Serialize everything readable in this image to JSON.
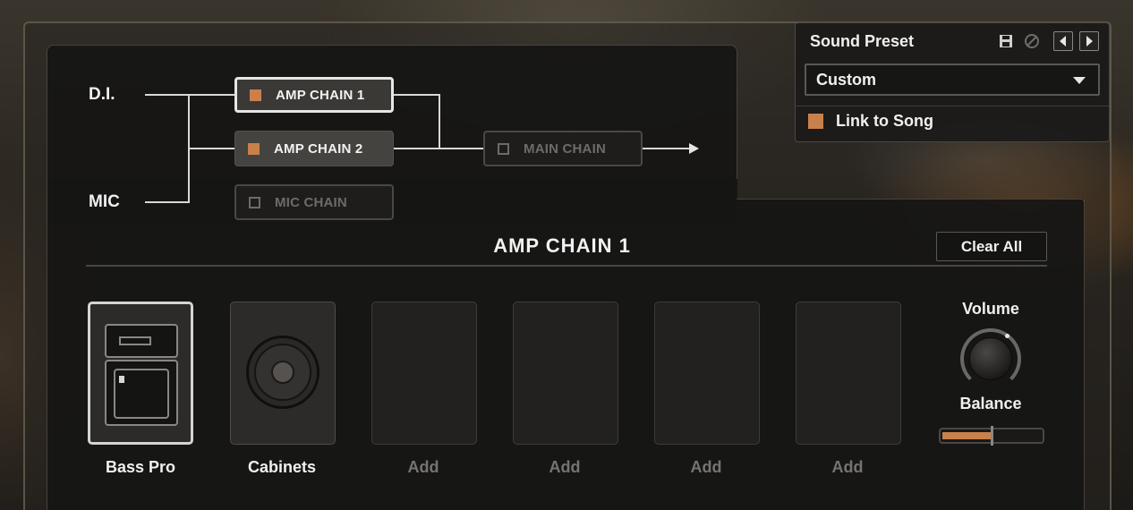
{
  "routing": {
    "inputs": [
      "D.I.",
      "MIC"
    ],
    "chains": [
      {
        "label": "AMP CHAIN 1",
        "state": "selected",
        "enabled": true
      },
      {
        "label": "AMP CHAIN 2",
        "state": "on",
        "enabled": true
      },
      {
        "label": "MIC CHAIN",
        "state": "off",
        "enabled": false
      }
    ],
    "main_chain": {
      "label": "MAIN CHAIN",
      "enabled": false
    }
  },
  "preset": {
    "title": "Sound Preset",
    "icons": [
      "save-icon",
      "cancel-icon",
      "prev-icon",
      "next-icon"
    ],
    "selected": "Custom",
    "link_label": "Link to Song",
    "link_checked": true
  },
  "chain": {
    "title": "AMP CHAIN 1",
    "clear_label": "Clear All",
    "slots": [
      {
        "label": "Bass Pro",
        "kind": "amp",
        "selected": true
      },
      {
        "label": "Cabinets",
        "kind": "cabinet",
        "selected": false
      },
      {
        "label": "Add",
        "kind": "empty",
        "selected": false
      },
      {
        "label": "Add",
        "kind": "empty",
        "selected": false
      },
      {
        "label": "Add",
        "kind": "empty",
        "selected": false
      },
      {
        "label": "Add",
        "kind": "empty",
        "selected": false
      }
    ]
  },
  "output": {
    "volume_label": "Volume",
    "balance_label": "Balance",
    "balance_fill_fraction": 0.5
  },
  "colors": {
    "accent": "#c9814c",
    "panel": "#161514",
    "text": "#f0f0f0",
    "dim_text": "#77746f"
  }
}
